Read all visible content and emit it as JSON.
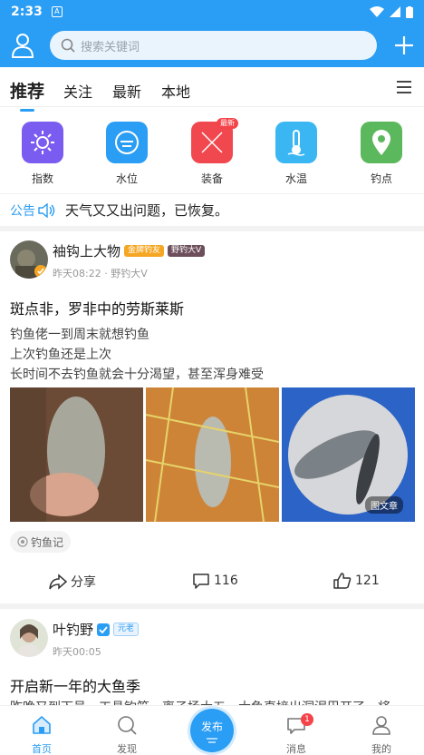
{
  "status": {
    "time": "2:33",
    "badge": "A"
  },
  "header": {
    "search_placeholder": "搜索关键词"
  },
  "tabs": [
    "推荐",
    "关注",
    "最新",
    "本地"
  ],
  "categories": [
    {
      "label": "指数",
      "icon": "sun-icon",
      "color": "#7b5cf0"
    },
    {
      "label": "水位",
      "icon": "water-level-icon",
      "color": "#2a9df4"
    },
    {
      "label": "装备",
      "icon": "gear-equipment-icon",
      "color": "#f0484e",
      "tag": "最新"
    },
    {
      "label": "水温",
      "icon": "thermometer-icon",
      "color": "#3ab7f3"
    },
    {
      "label": "钓点",
      "icon": "location-pin-icon",
      "color": "#5cb85c"
    }
  ],
  "notice": {
    "label": "公告",
    "text": "天气又又出问题，已恢复。"
  },
  "posts": [
    {
      "username": "袖钩上大物",
      "badges": [
        "金牌钓友",
        "野钓大V"
      ],
      "meta": "昨天08:22 · 野钓大V",
      "title": "斑点非，罗非中的劳斯莱斯",
      "lines": [
        "钓鱼佬一到周末就想钓鱼",
        "上次钓鱼还是上次",
        "长时间不去钓鱼就会十分渴望，甚至浑身难受"
      ],
      "photo_caption": "图文章",
      "topic": "钓鱼记",
      "share_label": "分享",
      "comments": "116",
      "likes": "121"
    },
    {
      "username": "叶钓野",
      "badges": [
        "元老"
      ],
      "meta": "昨天00:05",
      "title": "开启新一年的大鱼季",
      "snippet": "昨晚又到下号，工具钓竿，离子扬大五，大鱼直接出洞泥巴开了，将"
    }
  ],
  "nav": [
    {
      "label": "首页",
      "icon": "home-icon"
    },
    {
      "label": "发现",
      "icon": "discover-icon"
    },
    {
      "label": "发布",
      "icon": "publish-icon"
    },
    {
      "label": "消息",
      "icon": "message-icon",
      "count": "1"
    },
    {
      "label": "我的",
      "icon": "profile-icon"
    }
  ]
}
